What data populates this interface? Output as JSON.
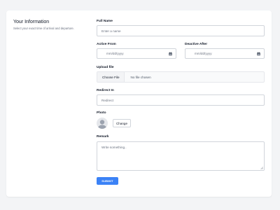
{
  "section": {
    "title": "Your Information",
    "description": "Select your exact time of arrival and departure."
  },
  "form": {
    "full_name": {
      "label": "Full Name",
      "placeholder": "Enter a name"
    },
    "active_from": {
      "label": "Active From",
      "placeholder": "mm/dd/yyyy"
    },
    "deactive_after": {
      "label": "Deactive After",
      "placeholder": "mm/dd/yyyy"
    },
    "upload": {
      "label": "Upload file",
      "button": "Choose File",
      "status": "No file chosen"
    },
    "redirect": {
      "label": "Redirect In",
      "placeholder": "Redirect"
    },
    "photo": {
      "label": "Photo",
      "change_button": "Change"
    },
    "remark": {
      "label": "Remark",
      "placeholder": "Write something.."
    },
    "submit": "SUBMIT"
  },
  "colors": {
    "accent": "#3b82f6",
    "background": "#f3f4f6",
    "card": "#ffffff",
    "border": "#d1d5db"
  },
  "icons": {
    "date_icon": "calendar-icon",
    "avatar": "user-silhouette-icon",
    "resize": "resize-grip-icon"
  }
}
